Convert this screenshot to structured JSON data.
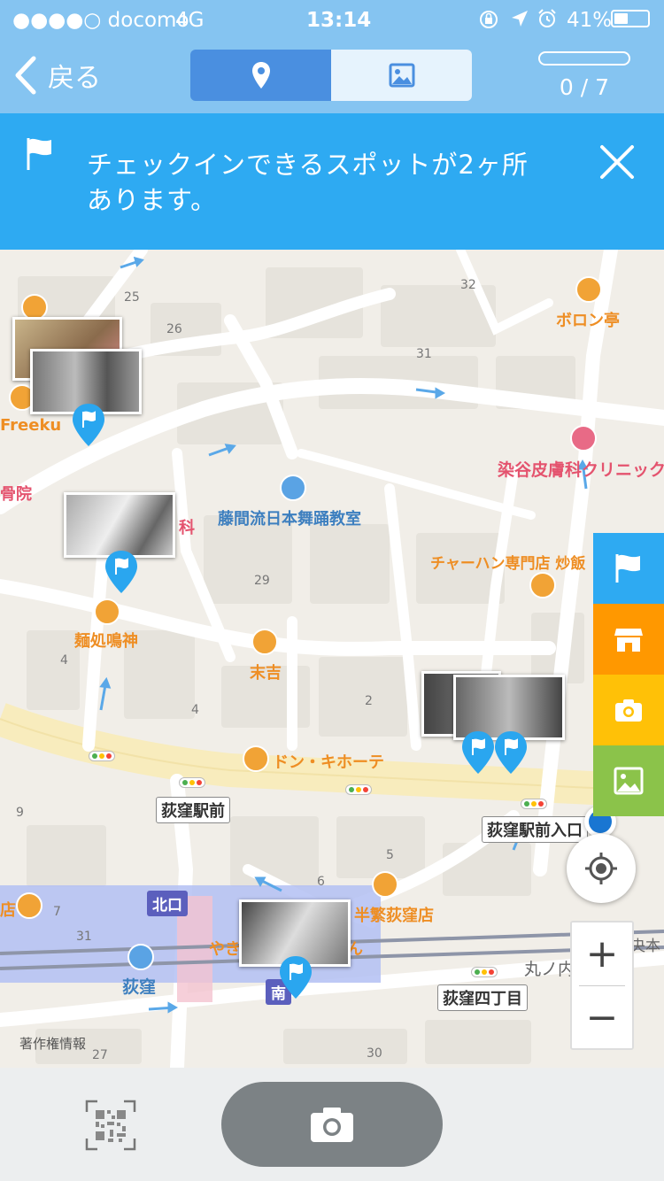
{
  "status": {
    "carrier": "●●●●○ docomo",
    "network": "4G",
    "time": "13:14",
    "battery": "41%"
  },
  "nav": {
    "back_label": "戻る",
    "progress": "0 / 7",
    "progress_fraction": 0.0,
    "tab_map_icon": "location-pin-icon",
    "tab_gallery_icon": "image-icon",
    "active_tab": "map"
  },
  "banner": {
    "line1": "チェックインできるスポットが2ヶ所",
    "line2": "あります。",
    "icon": "flag-icon"
  },
  "map": {
    "places": {
      "boron": "ボロン亭",
      "someya": "染谷皮膚科クリニック",
      "fujima": "藤間流日本舞踊教室",
      "chahan": "チャーハン専門店 炒飯",
      "menya": "麺処鳴神",
      "sueyoshi": "末吉",
      "donki": "ドン・キホーテ",
      "freeku": "Freeku",
      "kotsuin": "骨院",
      "ka": "科",
      "ogikubo": "荻窪",
      "kitaguchi": "北口",
      "minami": "南",
      "ramen_partial": "やき",
      "ramen_partial2": "ん",
      "hanshige": "半繁荻窪店",
      "kubo_left": "店",
      "marunouchi": "丸ノ内",
      "chuo": "央本"
    },
    "signs": {
      "ekimae": "荻窪駅前",
      "ekimae_iriguchi": "荻窪駅前入口",
      "yonchome": "荻窪四丁目"
    },
    "block_numbers": [
      "25",
      "26",
      "32",
      "31",
      "29",
      "4",
      "2",
      "9",
      "5",
      "6",
      "7",
      "31",
      "27",
      "30"
    ],
    "copyright": "著作権情報",
    "colors": {
      "spot_pin": "#2aa6ef",
      "water_route": "#5aa8e8",
      "station_area": "#a9b6f2"
    }
  },
  "side_buttons": [
    {
      "name": "checkin-spots",
      "icon": "flag-icon",
      "color": "#2eaaf2"
    },
    {
      "name": "shops",
      "icon": "store-icon",
      "color": "#ff9800"
    },
    {
      "name": "photo-spots",
      "icon": "camera-icon",
      "color": "#ffc107"
    },
    {
      "name": "gallery",
      "icon": "image-icon",
      "color": "#8bc34a"
    }
  ],
  "zoom": {
    "in": "+",
    "out": "−"
  },
  "bottom": {
    "qr_icon": "qr-code-icon",
    "camera_icon": "camera-icon"
  }
}
